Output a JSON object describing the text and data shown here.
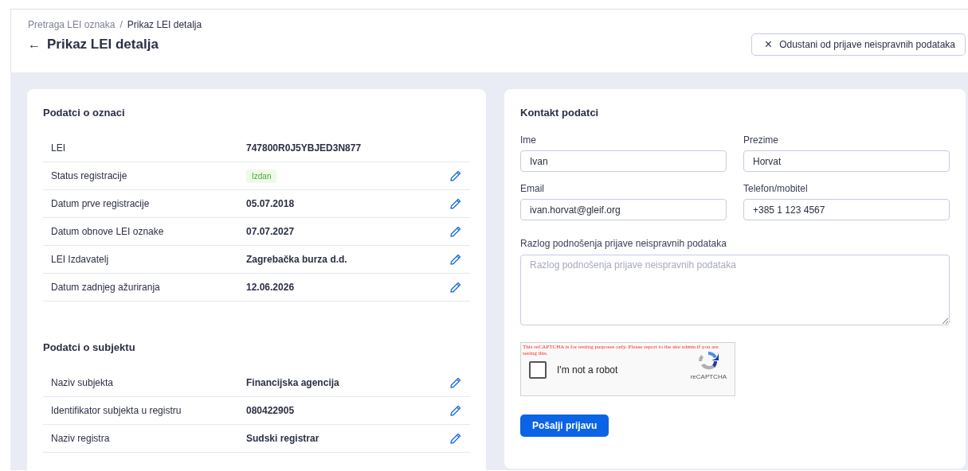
{
  "breadcrumb": [
    {
      "label": "Pretraga LEI oznaka",
      "current": false
    },
    {
      "label": "Prikaz LEI detalja",
      "current": true
    }
  ],
  "breadcrumb_separator": "/",
  "back_arrow": "←",
  "page_title": "Prikaz LEI detalja",
  "cancel_button": {
    "icon": "×",
    "label": "Odustani od prijave neispravnih podataka"
  },
  "sections": [
    {
      "title": "Podatci o oznaci",
      "rows": [
        {
          "label": "LEI",
          "value": "747800R0J5YBJED3N877",
          "kind": "text",
          "editable": false
        },
        {
          "label": "Status registracije",
          "value": "Izdan",
          "kind": "badge",
          "editable": true
        },
        {
          "label": "Datum prve registracije",
          "value": "05.07.2018",
          "kind": "text",
          "editable": true
        },
        {
          "label": "Datum obnove LEI oznake",
          "value": "07.07.2027",
          "kind": "text",
          "editable": true
        },
        {
          "label": "LEI Izdavatelj",
          "value": "Zagrebačka burza d.d.",
          "kind": "text",
          "editable": true
        },
        {
          "label": "Datum zadnjeg ažuriranja",
          "value": "12.06.2026",
          "kind": "text",
          "editable": true
        }
      ]
    },
    {
      "title": "Podatci o subjektu",
      "rows": [
        {
          "label": "Naziv subjekta",
          "value": "Financijska agencija",
          "kind": "text",
          "editable": true
        },
        {
          "label": "Identifikator subjekta u registru",
          "value": "080422905",
          "kind": "text",
          "editable": true
        },
        {
          "label": "Naziv registra",
          "value": "Sudski registrar",
          "kind": "text",
          "editable": true
        }
      ]
    }
  ],
  "contact": {
    "title": "Kontakt podatci",
    "fields": [
      {
        "label": "Ime",
        "value": "Ivan"
      },
      {
        "label": "Prezime",
        "value": "Horvat"
      },
      {
        "label": "Email",
        "value": "ivan.horvat@gleif.org"
      },
      {
        "label": "Telefon/mobitel",
        "value": "+385 1 123 4567"
      }
    ],
    "reason": {
      "label": "Razlog podnošenja prijave neispravnih podataka",
      "placeholder": "Razlog podnošenja prijave neispravnih podataka"
    },
    "captcha": {
      "warning": "This reCAPTCHA is for testing purposes only. Please report to the site admin if you are seeing this.",
      "label": "I'm not a robot",
      "checked": false,
      "brand": "reCAPTCHA"
    },
    "submit": "Pošalji prijavu"
  }
}
